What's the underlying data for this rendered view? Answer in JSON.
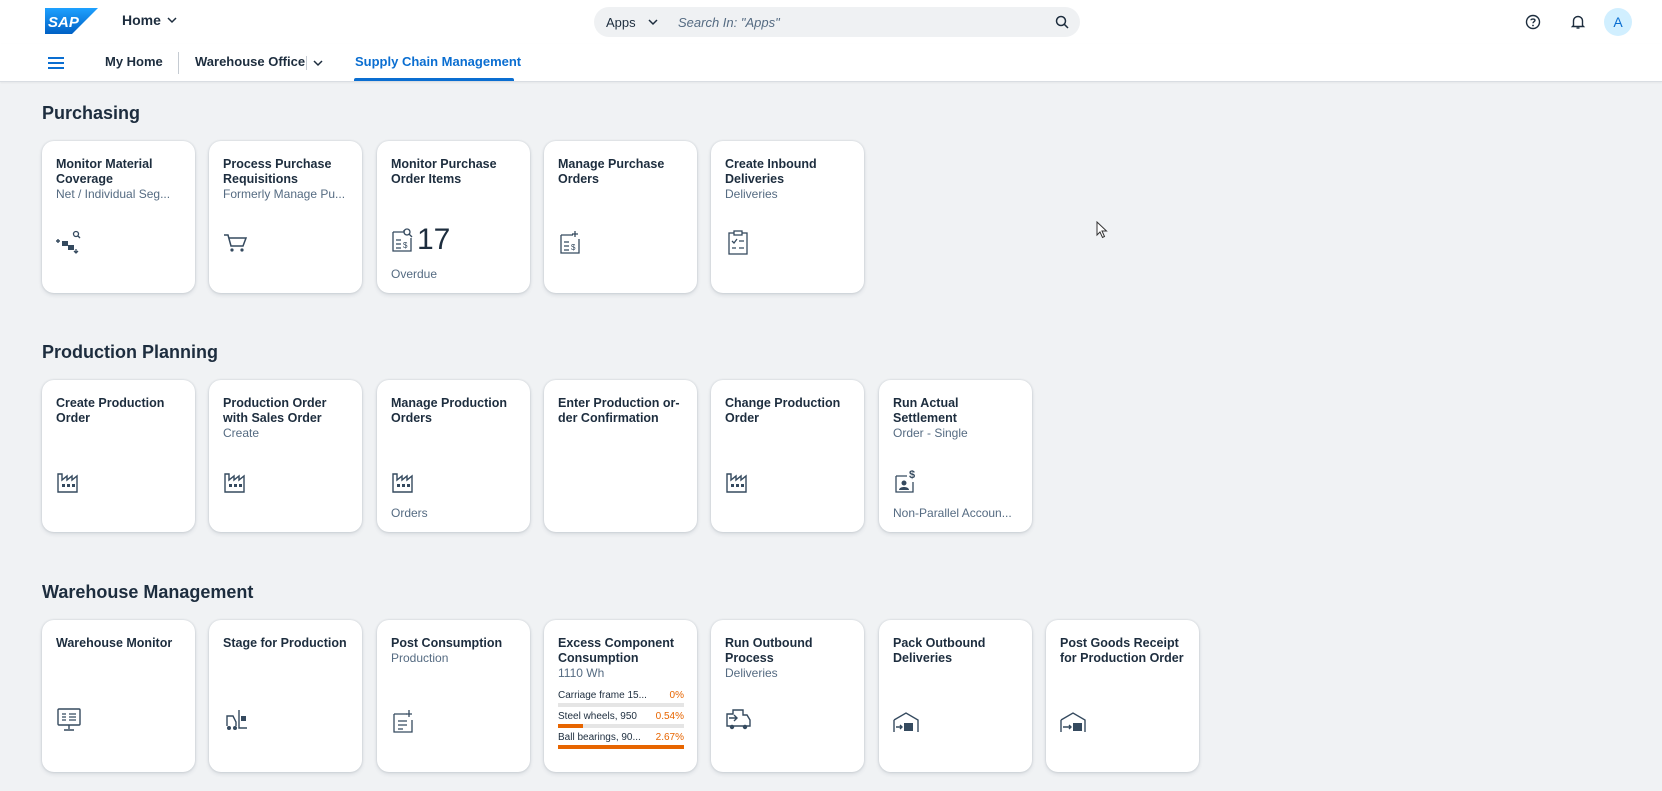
{
  "shell": {
    "logo_text": "SAP",
    "home_label": "Home",
    "search_scope": "Apps",
    "search_placeholder": "Search In: \"Apps\"",
    "avatar_initial": "A"
  },
  "nav": {
    "my_home": "My Home",
    "warehouse_office": "Warehouse Office",
    "supply_chain": "Supply Chain Management"
  },
  "colors": {
    "accent": "#0a6ed1",
    "critical": "#e76500",
    "background": "#f0f2f4"
  },
  "sections": [
    {
      "title": "Purchasing",
      "tiles": [
        {
          "title": "Monitor Material Coverage",
          "subtitle": "Net / Individual Seg...",
          "icon": "material-coverage-icon"
        },
        {
          "title": "Process Purchase Requisitions",
          "subtitle": "Formerly Manage Pu...",
          "icon": "cart-icon"
        },
        {
          "title": "Monitor Purchase Order Items",
          "subtitle": "",
          "icon": "purchase-doc-search-icon",
          "kpi": "17",
          "footer": "Overdue"
        },
        {
          "title": "Manage Purchase Orders",
          "subtitle": "",
          "icon": "purchase-doc-icon"
        },
        {
          "title": "Create Inbound Deliveries",
          "subtitle": "Deliveries",
          "icon": "checklist-icon"
        }
      ]
    },
    {
      "title": "Production Planning",
      "tiles": [
        {
          "title": "Create Production Order",
          "subtitle": "",
          "icon": "factory-icon"
        },
        {
          "title": "Production Order with Sales Order",
          "subtitle": "Create",
          "icon": "factory-icon"
        },
        {
          "title": "Manage Production Orders",
          "subtitle": "",
          "icon": "factory-icon",
          "footer": "Orders"
        },
        {
          "title": "Enter Production or-der Confirmation",
          "subtitle": ""
        },
        {
          "title": "Change Production Order",
          "subtitle": "",
          "icon": "factory-icon"
        },
        {
          "title": "Run Actual Settlement",
          "subtitle": "Order - Single",
          "icon": "settlement-icon",
          "footer": "Non-Parallel Accoun..."
        }
      ]
    },
    {
      "title": "Warehouse Management",
      "tiles": [
        {
          "title": "Warehouse Monitor",
          "subtitle": "",
          "icon": "monitor-icon"
        },
        {
          "title": "Stage for Production",
          "subtitle": "",
          "icon": "forklift-icon"
        },
        {
          "title": "Post Consumption",
          "subtitle": "Production",
          "icon": "post-document-icon"
        },
        {
          "title": "Excess Component Consumption",
          "subtitle": "1110 Wh",
          "bars": [
            {
              "label": "Carriage frame 15...",
              "pct": "0%",
              "fill": 0.0
            },
            {
              "label": "Steel wheels, 950",
              "pct": "0.54%",
              "fill": 0.2
            },
            {
              "label": "Ball bearings, 90...",
              "pct": "2.67%",
              "fill": 1.0
            }
          ]
        },
        {
          "title": "Run Outbound Process",
          "subtitle": "Deliveries",
          "icon": "shipping-icon"
        },
        {
          "title": "Pack Outbound Deliveries",
          "subtitle": "",
          "icon": "warehouse-out-icon"
        },
        {
          "title": "Post Goods Receipt for Production Order",
          "subtitle": "",
          "icon": "warehouse-in-icon"
        }
      ]
    }
  ]
}
